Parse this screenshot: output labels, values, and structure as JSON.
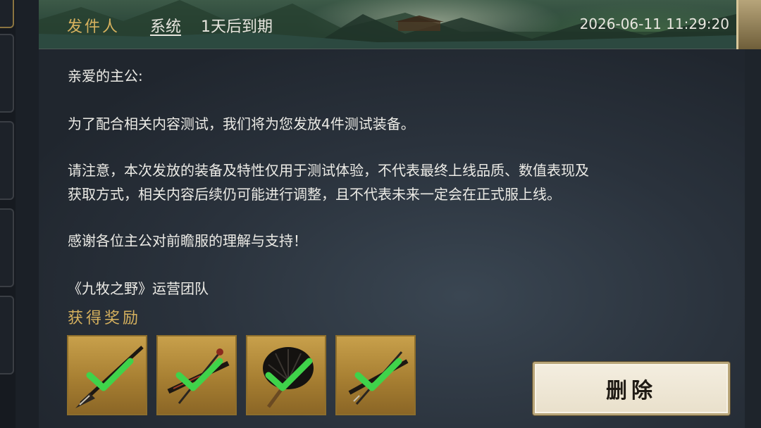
{
  "header": {
    "sender_label": "发件人",
    "sender_name": "系统",
    "expires": "1天后到期",
    "timestamp": "2026-06-11 11:29:20"
  },
  "message": {
    "greeting": "亲爱的主公:",
    "para1": "为了配合相关内容测试，我们将为您发放4件测试装备。",
    "para2_line1": "请注意，本次发放的装备及特性仅用于测试体验，不代表最终上线品质、数值表现及",
    "para2_line2": "获取方式，相关内容后续仍可能进行调整，且不代表未来一定会在正式服上线。",
    "para3": "感谢各位主公对前瞻服的理解与支持！",
    "signature": "《九牧之野》运营团队"
  },
  "rewards": {
    "title": "获得奖励",
    "items": [
      {
        "icon": "spear-icon",
        "claimed": true
      },
      {
        "icon": "sword-icon",
        "claimed": true
      },
      {
        "icon": "feather-fan-icon",
        "claimed": true
      },
      {
        "icon": "dagger-icon",
        "claimed": true
      }
    ]
  },
  "actions": {
    "delete_label": "删除"
  },
  "colors": {
    "gold_text": "#d6b15e",
    "body_text": "#ecebe6",
    "check_green": "#3fd34a",
    "button_bg": "#f1eadb"
  }
}
